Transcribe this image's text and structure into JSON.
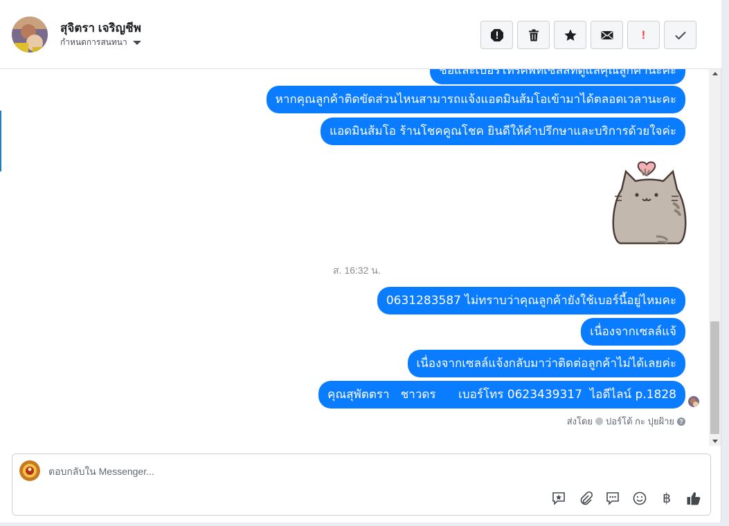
{
  "header": {
    "contact_name": "สุจิตรา เจริญชีพ",
    "conversation_settings": "กำหนดการสนทนา",
    "actions": [
      "report-icon",
      "trash-icon",
      "star-icon",
      "envelope-icon",
      "important-icon",
      "check-icon"
    ],
    "important_label": "!"
  },
  "thread": {
    "messages": [
      "ชื่อและเบอร์โทรศัพท์เซลล์ที่ดูแลคุณลูกค้านะคะ",
      "หากคุณลูกค้าติดขัดส่วนไหนสามารถแจ้งแอดมินส้มโอเข้ามาได้ตลอดเวลานะคะ",
      "แอดมินส้มโอ ร้านโชคคูณโชค ยินดีให้คำปรึกษาและบริการด้วยใจค่ะ",
      "0631283587 ไม่ทราบว่าคุณลูกค้ายังใช้เบอร์นี้อยู่ไหมคะ",
      "เนื่องจากเซลล์แจ้",
      "เนื่องจากเซลล์แจ้งกลับมาว่าติดต่อลูกค้าไม่ได้เลยค่ะ",
      "คุณสุพัตตรา   ชาวดร      เบอร์โทร 0623439317  ไอดีไลน์ p.1828"
    ],
    "sticker": "pusheen-cat-heart-sticker",
    "timestamp": "ส. 16:32 น.",
    "sent_by_prefix": "ส่งโดย",
    "sent_by_name": "ปอร์โต้ กะ ปุยฝ้าย"
  },
  "composer": {
    "placeholder": "ตอบกลับใน Messenger...",
    "tools": [
      "saved-reply-icon",
      "attachment-icon",
      "chat-bubble-icon",
      "emoji-icon",
      "baht-icon",
      "like-icon"
    ],
    "baht_symbol": "฿"
  },
  "colors": {
    "bubble": "#0a7cff",
    "accent": "#1f7fb8"
  }
}
